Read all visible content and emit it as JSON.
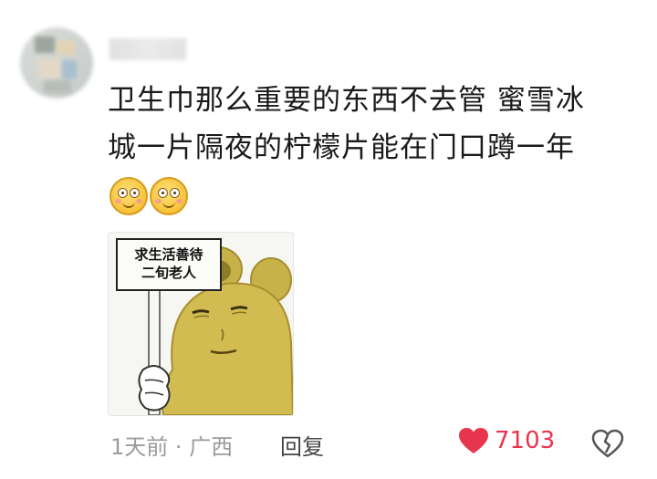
{
  "comment": {
    "avatar": "avatar-blurred",
    "username": "",
    "text_line1": "卫生巾那么重要的东西不去管 蜜雪冰",
    "text_line2": "城一片隔夜的柠檬片能在门口蹲一年",
    "emojis": [
      "smiling-face-emoji",
      "smiling-face-emoji"
    ],
    "meme_sign_line1": "求生活善待",
    "meme_sign_line2": "二旬老人",
    "time": "1天前",
    "separator": "·",
    "location": "广西",
    "reply_label": "回复",
    "like_count": "7103",
    "like_icon": "heart-icon",
    "dislike_icon": "broken-heart-icon"
  },
  "colors": {
    "like": "#e8354e",
    "meta_text": "#9b9b9b",
    "body_text": "#1a1a1a"
  }
}
